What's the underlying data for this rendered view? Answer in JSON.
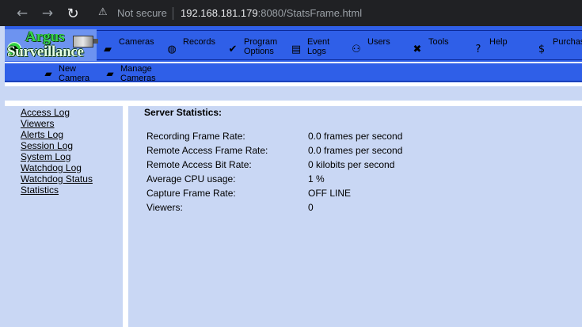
{
  "browser": {
    "nav_back_icon": "←",
    "nav_forward_icon": "→",
    "reload_icon": "↻",
    "warning_icon": "⚠",
    "security_text": "Not secure",
    "url_host": "192.168.181.179",
    "url_rest": ":8080/StatsFrame.html"
  },
  "logo": {
    "line1": "Argus",
    "line2": "Surveillance"
  },
  "menu": {
    "items": [
      {
        "icon": "camera-icon",
        "glyph": "▰",
        "label": "Cameras"
      },
      {
        "icon": "records-disc-icon",
        "glyph": "◍",
        "label": "Records"
      },
      {
        "icon": "checkmark-icon",
        "glyph": "✔",
        "label": "Program\nOptions"
      },
      {
        "icon": "document-icon",
        "glyph": "▤",
        "label": "Event\nLogs"
      },
      {
        "icon": "users-icon",
        "glyph": "⚇",
        "label": "Users"
      },
      {
        "icon": "tools-icon",
        "glyph": "✖",
        "label": "Tools"
      },
      {
        "icon": "help-icon",
        "glyph": "?",
        "label": "Help"
      },
      {
        "icon": "dollar-icon",
        "glyph": "$",
        "label": "Purchase"
      }
    ]
  },
  "submenu": {
    "items": [
      {
        "icon": "new-camera-icon",
        "glyph": "▰",
        "label": "New\nCamera"
      },
      {
        "icon": "manage-cameras-icon",
        "glyph": "▰",
        "label": "Manage\nCameras"
      }
    ]
  },
  "sidebar": {
    "links": [
      "Access Log",
      "Viewers",
      "Alerts Log",
      "Session Log",
      "System Log",
      "Watchdog Log",
      "Watchdog Status",
      "Statistics"
    ]
  },
  "stats": {
    "title": "Server Statistics:",
    "rows": [
      {
        "label": "Recording Frame Rate:",
        "value": "0.0 frames per second"
      },
      {
        "label": "Remote Access Frame Rate:",
        "value": "0.0 frames per second"
      },
      {
        "label": "Remote Access Bit Rate:",
        "value": "0 kilobits per second"
      },
      {
        "label": "Average CPU usage:",
        "value": "1 %"
      },
      {
        "label": "Capture Frame Rate:",
        "value": "OFF LINE"
      },
      {
        "label": "Viewers:",
        "value": "0"
      }
    ]
  },
  "colors": {
    "menu_blue": "#2f5fe8",
    "panel_light_blue": "#c9d7f4",
    "chrome_dark": "#202124"
  }
}
